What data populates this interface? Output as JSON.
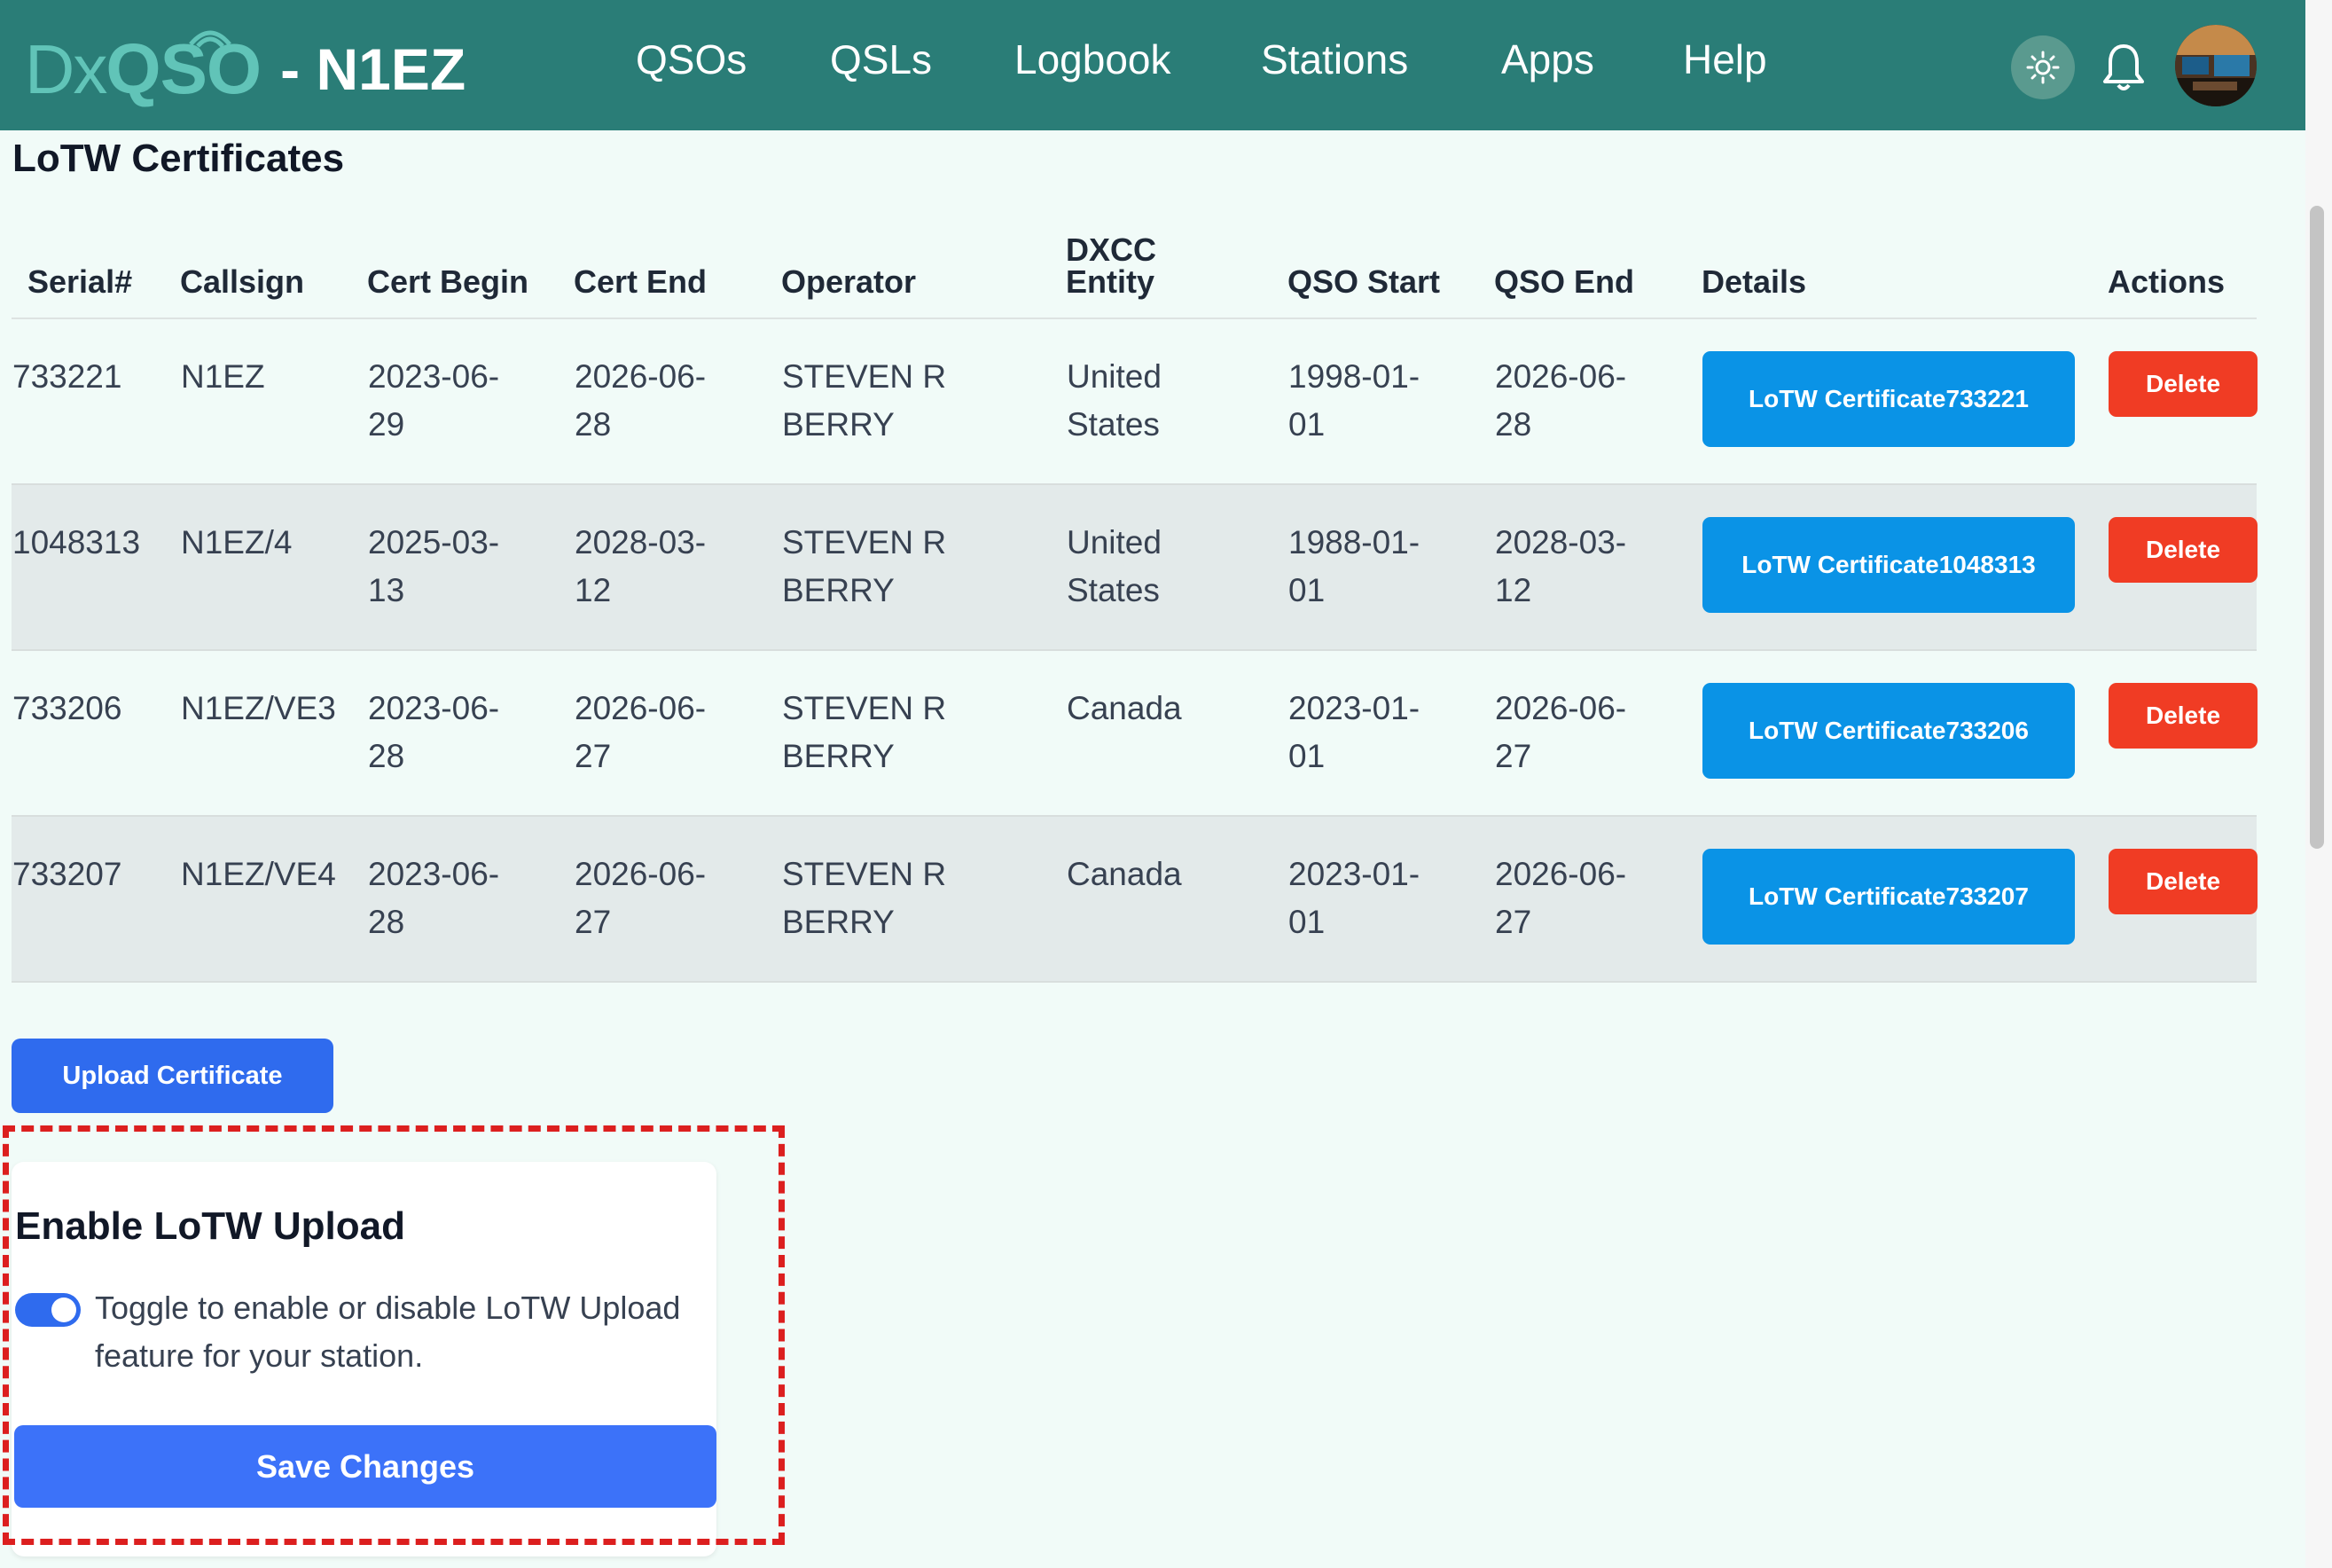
{
  "navbar": {
    "logo_dx": "Dx",
    "logo_qso": "QSO",
    "callsign": "- N1EZ",
    "links": [
      "QSOs",
      "QSLs",
      "Logbook",
      "Stations",
      "Apps",
      "Help"
    ]
  },
  "page": {
    "title": "LoTW Certificates"
  },
  "table": {
    "headers": [
      "Serial#",
      "Callsign",
      "Cert Begin",
      "Cert End",
      "Operator",
      "DXCC Entity",
      "QSO Start",
      "QSO End",
      "Details",
      "Actions"
    ],
    "rows": [
      {
        "serial": "733221",
        "callsign": "N1EZ",
        "cert_begin": [
          "2023-06-",
          "29"
        ],
        "cert_end": [
          "2026-06-",
          "28"
        ],
        "operator": [
          "STEVEN R",
          "BERRY"
        ],
        "dxcc": [
          "United",
          "States"
        ],
        "qso_start": [
          "1998-01-",
          "01"
        ],
        "qso_end": [
          "2026-06-",
          "28"
        ],
        "details": [
          "LoTW Certificate",
          "733221"
        ],
        "action": "Delete"
      },
      {
        "serial": "1048313",
        "callsign": "N1EZ/4",
        "cert_begin": [
          "2025-03-",
          "13"
        ],
        "cert_end": [
          "2028-03-",
          "12"
        ],
        "operator": [
          "STEVEN R",
          "BERRY"
        ],
        "dxcc": [
          "United",
          "States"
        ],
        "qso_start": [
          "1988-01-",
          "01"
        ],
        "qso_end": [
          "2028-03-",
          "12"
        ],
        "details": [
          "LoTW Certificate",
          "1048313"
        ],
        "action": "Delete"
      },
      {
        "serial": "733206",
        "callsign": "N1EZ/VE3",
        "cert_begin": [
          "2023-06-",
          "28"
        ],
        "cert_end": [
          "2026-06-",
          "27"
        ],
        "operator": [
          "STEVEN R",
          "BERRY"
        ],
        "dxcc": [
          "Canada",
          ""
        ],
        "qso_start": [
          "2023-01-",
          "01"
        ],
        "qso_end": [
          "2026-06-",
          "27"
        ],
        "details": [
          "LoTW Certificate",
          "733206"
        ],
        "action": "Delete"
      },
      {
        "serial": "733207",
        "callsign": "N1EZ/VE4",
        "cert_begin": [
          "2023-06-",
          "28"
        ],
        "cert_end": [
          "2026-06-",
          "27"
        ],
        "operator": [
          "STEVEN R",
          "BERRY"
        ],
        "dxcc": [
          "Canada",
          ""
        ],
        "qso_start": [
          "2023-01-",
          "01"
        ],
        "qso_end": [
          "2026-06-",
          "27"
        ],
        "details": [
          "LoTW Certificate",
          "733207"
        ],
        "action": "Delete"
      }
    ]
  },
  "upload": {
    "label": "Upload Certificate"
  },
  "lotw_upload": {
    "title": "Enable LoTW Upload",
    "toggle_on": true,
    "description": "Toggle to enable or disable LoTW Upload feature for your station.",
    "save_label": "Save Changes"
  },
  "colors": {
    "navbar_bg": "#2a7d77",
    "page_bg": "#f1fbf8",
    "details_button": "#0a93e6",
    "delete_button": "#f03c24",
    "primary_button": "#2f6bee",
    "highlight": "#dc1f1f"
  },
  "icons": {
    "theme": "sun-icon",
    "notifications": "bell-icon",
    "profile": "avatar"
  }
}
